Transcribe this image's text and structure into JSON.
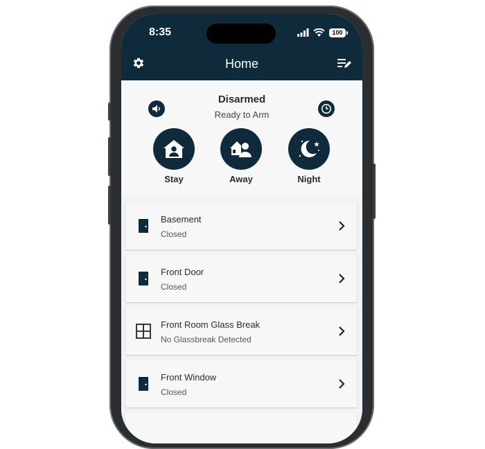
{
  "status_bar": {
    "time": "8:35",
    "battery": "100"
  },
  "header": {
    "title": "Home",
    "settings_icon": "gear-icon",
    "edit_icon": "edit-list-icon"
  },
  "arm": {
    "status": "Disarmed",
    "substatus": "Ready to Arm",
    "modes": [
      {
        "label": "Stay",
        "icon": "house-person-icon"
      },
      {
        "label": "Away",
        "icon": "person-leaving-icon"
      },
      {
        "label": "Night",
        "icon": "moon-stars-icon"
      }
    ]
  },
  "devices": [
    {
      "name": "Basement",
      "state": "Closed",
      "icon": "door-icon"
    },
    {
      "name": "Front Door",
      "state": "Closed",
      "icon": "door-icon"
    },
    {
      "name": "Front Room Glass Break",
      "state": "No Glassbreak Detected",
      "icon": "window-grid-icon"
    },
    {
      "name": "Front Window",
      "state": "Closed",
      "icon": "door-icon"
    }
  ],
  "colors": {
    "header_bg": "#0f2a3a",
    "screen_bg": "#f2f2f2",
    "card_bg": "#f7f7f7"
  }
}
